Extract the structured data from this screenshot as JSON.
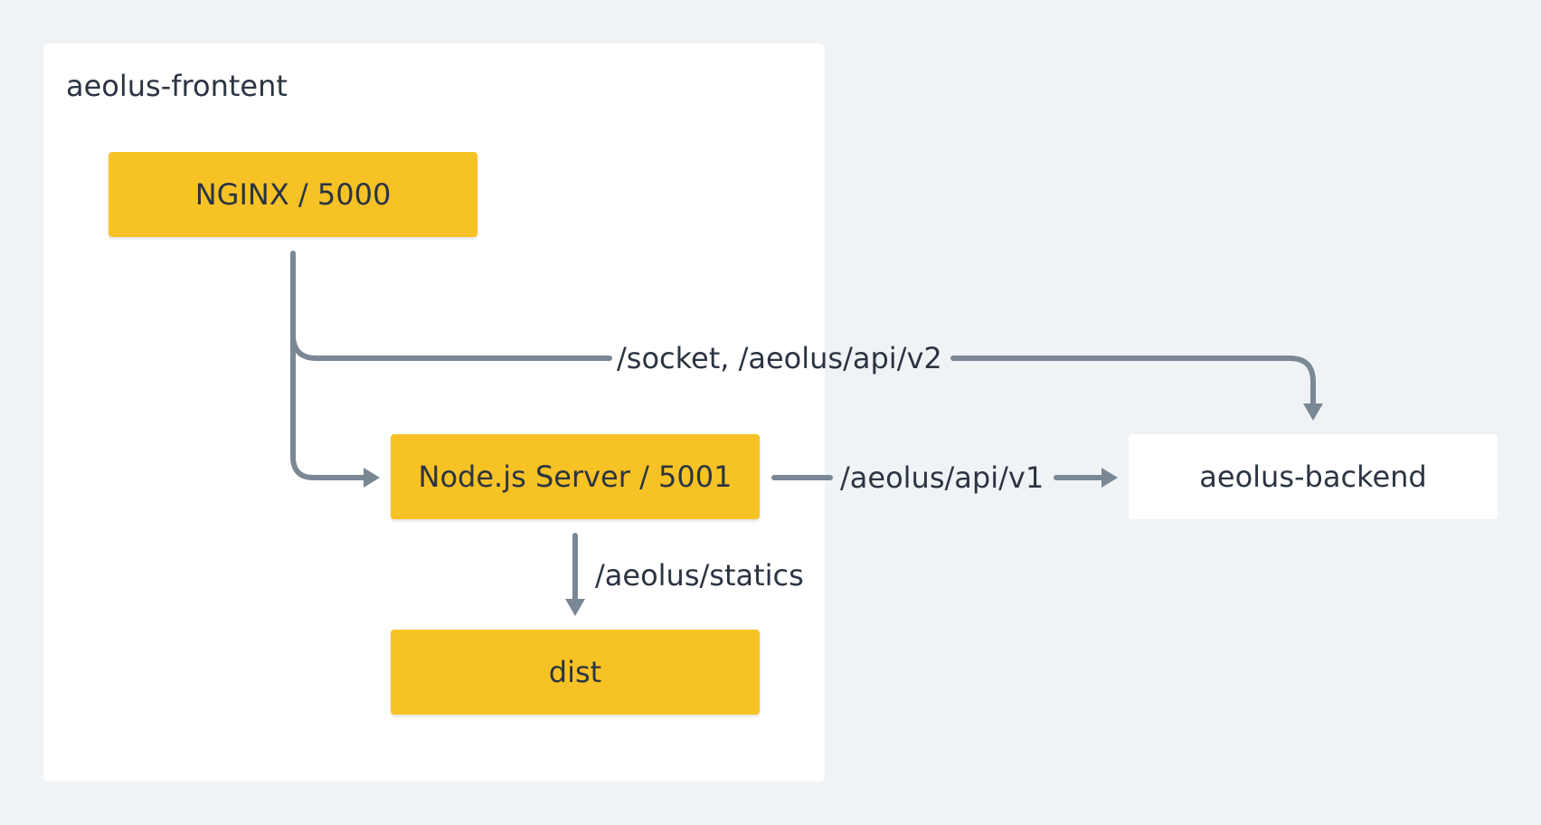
{
  "group": {
    "label": "aeolus-frontent"
  },
  "nodes": {
    "nginx": "NGINX / 5000",
    "node_server": "Node.js Server / 5001",
    "dist": "dist",
    "backend": "aeolus-backend"
  },
  "edges": {
    "socket_label": "/socket, /aeolus/api/v2",
    "api_v1_label": "/aeolus/api/v1",
    "statics_label": "/aeolus/statics"
  },
  "colors": {
    "background": "#f0f3f6",
    "node_fill": "#f7c225",
    "edge": "#7a8896",
    "text": "#2b3442"
  }
}
